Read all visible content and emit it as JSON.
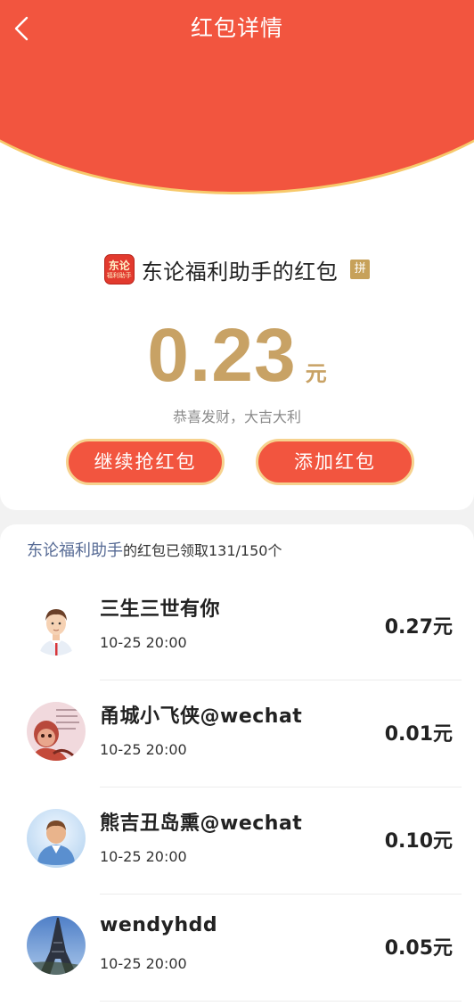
{
  "header": {
    "title": "红包详情",
    "back_icon": "chevron-left-icon"
  },
  "packet": {
    "sender_logo_line1": "东论",
    "sender_logo_line2": "福利助手",
    "sender_text": "东论福利助手的红包",
    "pin_badge": "拼",
    "amount": "0.23",
    "unit": "元",
    "greeting": "恭喜发财，大吉大利"
  },
  "actions": {
    "continue_label": "继续抢红包",
    "add_label": "添加红包"
  },
  "summary": {
    "sender_name": "东论福利助手",
    "status": "的红包已领取131/150个"
  },
  "receivers": [
    {
      "name": "三生三世有你",
      "time": "10-25 20:00",
      "amount": "0.27元",
      "avatar": "cartoon-man-avatar"
    },
    {
      "name": "甬城小飞侠@wechat",
      "time": "10-25 20:00",
      "amount": "0.01元",
      "avatar": "cartoon-character-avatar"
    },
    {
      "name": "熊吉丑岛熏@wechat",
      "time": "10-25 20:00",
      "amount": "0.10元",
      "avatar": "default-user-avatar"
    },
    {
      "name": "wendyhdd",
      "time": "10-25 20:00",
      "amount": "0.05元",
      "avatar": "eiffel-tower-avatar"
    }
  ],
  "colors": {
    "brand_red": "#f2553f",
    "gold": "#c8a265",
    "link_blue": "#576b95"
  }
}
